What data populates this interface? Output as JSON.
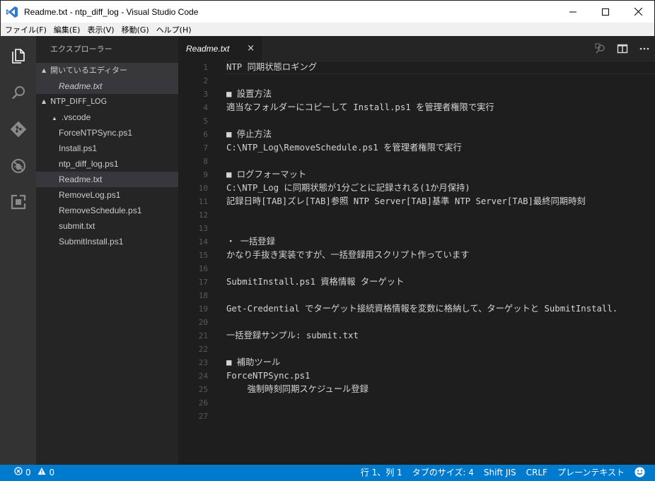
{
  "window": {
    "title": "Readme.txt - ntp_diff_log - Visual Studio Code",
    "logo_icon": "vscode-logo",
    "controls": [
      "minimize-icon",
      "maximize-icon",
      "close-icon"
    ]
  },
  "menu": [
    "ファイル(F)",
    "編集(E)",
    "表示(V)",
    "移動(G)",
    "ヘルプ(H)"
  ],
  "activity": [
    "files-icon",
    "search-icon",
    "git-icon",
    "debug-icon",
    "extensions-icon"
  ],
  "sidebar": {
    "title": "エクスプローラー",
    "open_editors_label": "開いているエディター",
    "open_editors": [
      "Readme.txt"
    ],
    "folder_label": "NTP_DIFF_LOG",
    "subfolder": ".vscode",
    "files": [
      "ForceNTPSync.ps1",
      "Install.ps1",
      "ntp_diff_log.ps1",
      "Readme.txt",
      "RemoveLog.ps1",
      "RemoveSchedule.ps1",
      "submit.txt",
      "SubmitInstall.ps1"
    ],
    "selected_file": "Readme.txt"
  },
  "tab": {
    "label": "Readme.txt",
    "close": "×"
  },
  "editor_actions": [
    "open-changes-icon",
    "split-editor-icon",
    "more-actions-icon"
  ],
  "editor": {
    "lines": [
      "NTP 同期状態ロギング",
      "",
      "■ 設置方法",
      "適当なフォルダーにコピーして Install.ps1 を管理者権限で実行",
      "",
      "■ 停止方法",
      "C:\\NTP_Log\\RemoveSchedule.ps1 を管理者権限で実行",
      "",
      "■ ログフォーマット",
      "C:\\NTP_Log に同期状態が1分ごとに記録される(1か月保持)",
      "記録日時[TAB]ズレ[TAB]参照 NTP Server[TAB]基準 NTP Server[TAB]最終同期時刻",
      "",
      "",
      "・ 一括登録",
      "かなり手抜き実装ですが、一括登録用スクリプト作っています",
      "",
      "SubmitInstall.ps1 資格情報 ターゲット",
      "",
      "Get-Credential でターゲット接続資格情報を変数に格納して、ターゲットと SubmitInstall.",
      "",
      "一括登録サンプル: submit.txt",
      "",
      "■ 補助ツール",
      "ForceNTPSync.ps1",
      "    強制時刻同期スケジュール登録",
      "",
      ""
    ]
  },
  "status": {
    "errors": "0",
    "warnings": "0",
    "position": "行 1、列 1",
    "tab_size": "タブのサイズ: 4",
    "encoding": "Shift JIS",
    "eol": "CRLF",
    "language": "プレーンテキスト",
    "feedback_icon": "smiley-icon"
  },
  "colors": {
    "statusbar": "#007acc",
    "activitybar": "#333333",
    "sidebar": "#252526",
    "editor": "#1e1e1e"
  }
}
